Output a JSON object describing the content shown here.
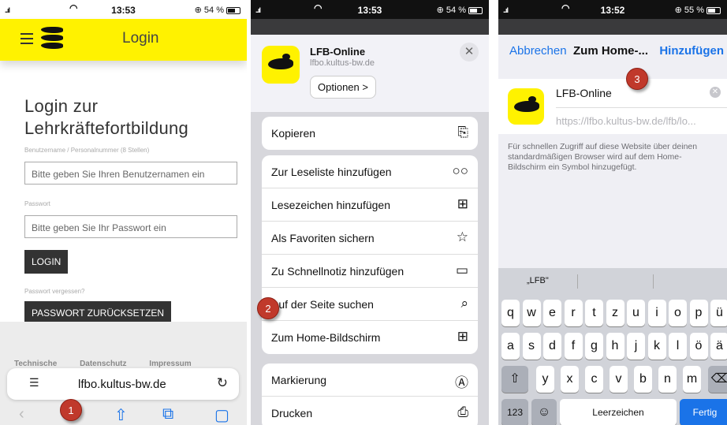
{
  "panel1": {
    "status": {
      "signal": "..ıl",
      "time": "13:53",
      "battery": "54 %"
    },
    "header_title": "Login",
    "heading_line1": "Login zur",
    "heading_line2": "Lehrkräftefortbildung",
    "username_label": "Benutzername / Personalnummer (8 Stellen)",
    "username_placeholder": "Bitte geben Sie Ihren Benutzernamen ein",
    "password_label": "Passwort",
    "password_placeholder": "Bitte geben Sie Ihr Passwort ein",
    "login_button": "LOGIN",
    "forgot_label": "Passwort vergessen?",
    "reset_button": "PASSWORT ZURÜCKSETZEN",
    "footer_links": [
      "Technische",
      "Datenschutz",
      "Impressum"
    ],
    "url": "lfbo.kultus-bw.de",
    "toolbar": {
      "back": "‹",
      "share": "⇧",
      "bookmarks": "⧉",
      "tabs": "▢"
    },
    "marker": "1"
  },
  "panel2": {
    "status": {
      "signal": "..ıl",
      "time": "13:53",
      "battery": "54 %"
    },
    "site_name": "LFB-Online",
    "site_url": "lfbo.kultus-bw.de",
    "options_label": "Optionen >",
    "close_label": "✕",
    "group1": [
      {
        "label": "Kopieren",
        "icon": "⎘"
      }
    ],
    "group2": [
      {
        "label": "Zur Leseliste hinzufügen",
        "icon": "○○"
      },
      {
        "label": "Lesezeichen hinzufügen",
        "icon": "⊞"
      },
      {
        "label": "Als Favoriten sichern",
        "icon": "☆"
      },
      {
        "label": "Zu Schnellnotiz hinzufügen",
        "icon": "▭"
      },
      {
        "label": "Auf der Seite suchen",
        "icon": "⌕"
      },
      {
        "label": "Zum Home-Bildschirm",
        "icon": "⊞"
      }
    ],
    "group3": [
      {
        "label": "Markierung",
        "icon": "Ⓐ"
      },
      {
        "label": "Drucken",
        "icon": "⎙"
      }
    ],
    "marker": "2"
  },
  "panel3": {
    "status": {
      "signal": "..ıl",
      "time": "13:52",
      "battery": "55 %"
    },
    "cancel": "Abbrechen",
    "title": "Zum Home-...",
    "add": "Hinzufügen",
    "name_value": "LFB-Online",
    "url_value": "https://lfbo.kultus-bw.de/lfb/lo...",
    "help_text": "Für schnellen Zugriff auf diese Website über deinen standardmäßigen Browser wird auf dem Home-Bildschirm ein Symbol hinzugefügt.",
    "suggestion": "„LFB\"",
    "row1": [
      "q",
      "w",
      "e",
      "r",
      "t",
      "z",
      "u",
      "i",
      "o",
      "p",
      "ü"
    ],
    "row2": [
      "a",
      "s",
      "d",
      "f",
      "g",
      "h",
      "j",
      "k",
      "l",
      "ö",
      "ä"
    ],
    "row3": [
      "y",
      "x",
      "c",
      "v",
      "b",
      "n",
      "m"
    ],
    "key_123": "123",
    "key_emoji": "☺",
    "key_space": "Leerzeichen",
    "key_done": "Fertig",
    "marker": "3"
  }
}
